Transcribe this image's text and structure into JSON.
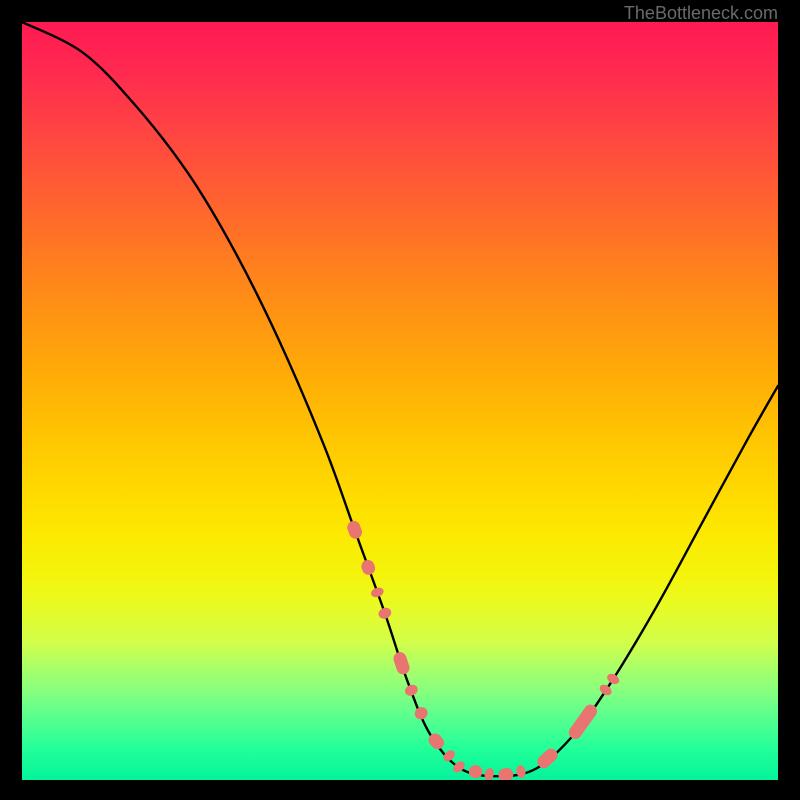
{
  "attribution": "TheBottleneck.com",
  "chart_data": {
    "type": "line",
    "title": "",
    "xlabel": "",
    "ylabel": "",
    "xlim": [
      0,
      100
    ],
    "ylim": [
      0,
      100
    ],
    "curve": {
      "description": "V-shaped bottleneck curve descending from top-left to a minimum near center-right then rising to right edge",
      "points_normalized": [
        {
          "x": 0.0,
          "y": 1.0
        },
        {
          "x": 0.08,
          "y": 0.96
        },
        {
          "x": 0.15,
          "y": 0.89
        },
        {
          "x": 0.22,
          "y": 0.8
        },
        {
          "x": 0.28,
          "y": 0.7
        },
        {
          "x": 0.34,
          "y": 0.58
        },
        {
          "x": 0.4,
          "y": 0.44
        },
        {
          "x": 0.44,
          "y": 0.33
        },
        {
          "x": 0.48,
          "y": 0.22
        },
        {
          "x": 0.51,
          "y": 0.13
        },
        {
          "x": 0.54,
          "y": 0.06
        },
        {
          "x": 0.58,
          "y": 0.015
        },
        {
          "x": 0.63,
          "y": 0.005
        },
        {
          "x": 0.68,
          "y": 0.015
        },
        {
          "x": 0.73,
          "y": 0.06
        },
        {
          "x": 0.78,
          "y": 0.13
        },
        {
          "x": 0.84,
          "y": 0.23
        },
        {
          "x": 0.9,
          "y": 0.34
        },
        {
          "x": 0.96,
          "y": 0.45
        },
        {
          "x": 1.0,
          "y": 0.52
        }
      ]
    },
    "markers": {
      "description": "Salmon-colored capsule markers along lower portions of the V curve",
      "color": "#e97570",
      "points_normalized": [
        {
          "x": 0.44,
          "y": 0.305,
          "len": 0.024
        },
        {
          "x": 0.458,
          "y": 0.262,
          "len": 0.02
        },
        {
          "x": 0.47,
          "y": 0.232,
          "len": 0.012
        },
        {
          "x": 0.48,
          "y": 0.206,
          "len": 0.014
        },
        {
          "x": 0.502,
          "y": 0.15,
          "len": 0.03
        },
        {
          "x": 0.515,
          "y": 0.115,
          "len": 0.014
        },
        {
          "x": 0.528,
          "y": 0.084,
          "len": 0.016
        },
        {
          "x": 0.548,
          "y": 0.043,
          "len": 0.022
        },
        {
          "x": 0.565,
          "y": 0.016,
          "len": 0.012
        },
        {
          "x": 0.578,
          "y": 0.006,
          "len": 0.012
        },
        {
          "x": 0.6,
          "y": 0.0015,
          "len": 0.018
        },
        {
          "x": 0.618,
          "y": 0.0015,
          "len": 0.012
        },
        {
          "x": 0.64,
          "y": 0.008,
          "len": 0.02
        },
        {
          "x": 0.66,
          "y": 0.018,
          "len": 0.012
        },
        {
          "x": 0.695,
          "y": 0.058,
          "len": 0.03
        },
        {
          "x": 0.742,
          "y": 0.138,
          "len": 0.052
        },
        {
          "x": 0.772,
          "y": 0.195,
          "len": 0.012
        },
        {
          "x": 0.782,
          "y": 0.216,
          "len": 0.012
        }
      ]
    }
  }
}
